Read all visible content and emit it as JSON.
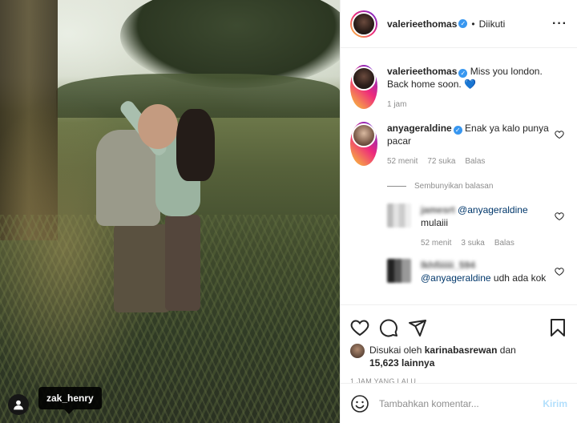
{
  "photo": {
    "tagged_user": "zak_henry"
  },
  "header": {
    "username": "valerieethomas",
    "separator": "•",
    "follow_status": "Diikuti",
    "more": "···"
  },
  "caption": {
    "username": "valerieethomas",
    "text": "Miss you london. Back home soon. 💙",
    "time": "1 jam"
  },
  "comment": {
    "username": "anyageraldine",
    "text": "Enak ya kalo punya pacar",
    "time": "52 menit",
    "likes": "72 suka",
    "reply_label": "Balas"
  },
  "replies_toggle": "Sembunyikan balasan",
  "replies": [
    {
      "username": "jamesrt",
      "mention": "@anyageraldine",
      "text": "mulaiii",
      "time": "52 menit",
      "likes": "3 suka",
      "reply_label": "Balas"
    },
    {
      "username": "lkhfiiiiii_594",
      "mention": "@anyageraldine",
      "text": "udh ada kok"
    }
  ],
  "likes": {
    "prefix": "Disukai oleh",
    "user": "karinabasrewan",
    "conj": "dan",
    "count": "15,623 lainnya"
  },
  "post_time": "1 JAM YANG LALU",
  "add_comment": {
    "placeholder": "Tambahkan komentar...",
    "send_label": "Kirim"
  },
  "icons": {
    "like": "heart-icon",
    "comment": "comment-icon",
    "share": "send-icon",
    "save": "bookmark-icon",
    "emoji": "emoji-icon",
    "user_tag": "user-icon"
  },
  "colors": {
    "verified": "#3897f0",
    "mention": "#00376b",
    "muted": "#8e8e8e",
    "send_disabled": "#b2dffc"
  }
}
